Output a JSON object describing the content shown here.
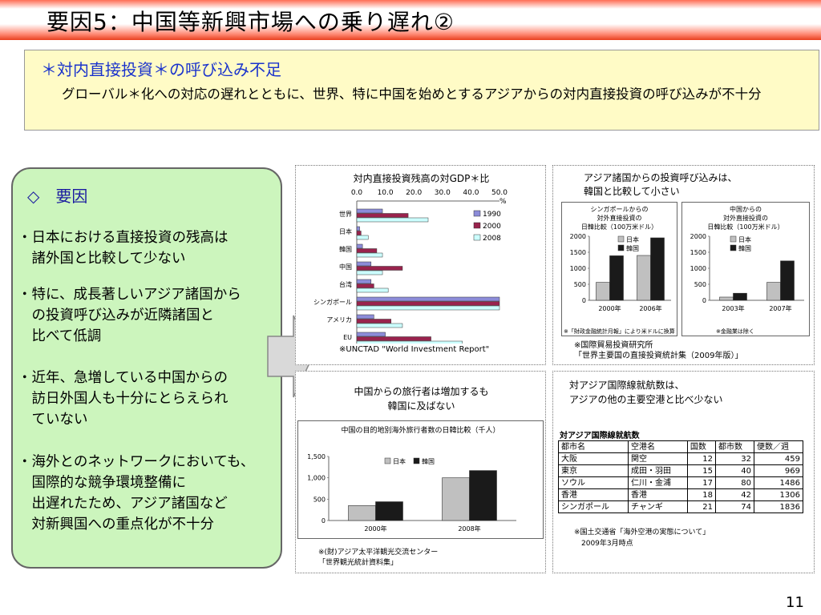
{
  "title": "要因5：中国等新興市場への乗り遅れ②",
  "subtitle": {
    "heading": "＊対内直接投資＊の呼び込み不足",
    "body": "グローバル＊化への対応の遅れとともに、世界、特に中国を始めとするアジアからの対内直接投資の呼び込みが不十分"
  },
  "factors": {
    "heading": "◇　要因",
    "items": [
      "・日本における直接投資の残高は\n　諸外国と比較して少ない",
      "・特に、成長著しいアジア諸国から\n　の投資呼び込みが近隣諸国と\n　比べて低調",
      "・近年、急増している中国からの\n　訪日外国人も十分にとらえられ\n　ていない",
      "・海外とのネットワークにおいても、\n　国際的な競争環境整備に\n　出遅れたため、アジア諸国など\n　対新興国への重点化が不十分"
    ]
  },
  "fdi_panel": {
    "note": "※UNCTAD \"World Investment Report\"",
    "chart_data": {
      "type": "bar",
      "orientation": "horizontal",
      "title": "対内直接投資残高の対GDP＊比",
      "unit": "%",
      "xlim": [
        0,
        50
      ],
      "xticks": [
        "0.0",
        "10.0",
        "20.0",
        "30.0",
        "40.0",
        "50.0"
      ],
      "categories": [
        "世界",
        "日本",
        "韓国",
        "中国",
        "台湾",
        "シンガポール",
        "アメリカ",
        "EU"
      ],
      "series": [
        {
          "name": "1990",
          "color": "#8c8cd9",
          "values": [
            9,
            1,
            2,
            5,
            5,
            50,
            6,
            10
          ]
        },
        {
          "name": "2000",
          "color": "#99234d",
          "values": [
            18,
            1.5,
            7,
            16,
            6,
            50,
            12,
            26
          ]
        },
        {
          "name": "2008",
          "color": "#ccffff",
          "values": [
            25,
            4,
            9,
            9,
            11,
            50,
            16,
            37
          ]
        }
      ]
    }
  },
  "asia_invest_panel": {
    "heading": "アジア諸国からの投資呼び込みは、\n韓国と比較して小さい",
    "note": "※国際貿易投資研究所\n「世界主要国の直接投資統計集（2009年版）」",
    "charts": [
      {
        "type": "bar",
        "title": "シンガポールからの\n対外直接投資の\n日韓比較（100万米ドル）",
        "categories": [
          "2000年",
          "2006年"
        ],
        "ylim": [
          0,
          2000
        ],
        "yticks": [
          "0",
          "500",
          "1000",
          "1500",
          "2000"
        ],
        "series": [
          {
            "name": "日本",
            "color": "#c0c0c0",
            "values": [
              560,
              1400
            ]
          },
          {
            "name": "韓国",
            "color": "#1a1a1a",
            "values": [
              1390,
              1950
            ]
          }
        ],
        "footnote": "※「財政金融統計月報」により米ドルに換算"
      },
      {
        "type": "bar",
        "title": "中国からの\n対外直接投資の\n日韓比較（100万米ドル）",
        "categories": [
          "2003年",
          "2007年"
        ],
        "ylim": [
          0,
          2000
        ],
        "yticks": [
          "0",
          "500",
          "1000",
          "1500",
          "2000"
        ],
        "series": [
          {
            "name": "日本",
            "color": "#c0c0c0",
            "values": [
              100,
              560
            ]
          },
          {
            "name": "韓国",
            "color": "#1a1a1a",
            "values": [
              220,
              1230
            ]
          }
        ],
        "footnote": "※金融業は除く"
      }
    ]
  },
  "tourist_panel": {
    "heading": "中国からの旅行者は増加するも\n韓国に及ばない",
    "note": "※(財)アジア太平洋観光交流センター\n「世界観光統計資料集」",
    "chart_data": {
      "type": "bar",
      "title": "中国の目的地別海外旅行者数の日韓比較（千人）",
      "categories": [
        "2000年",
        "2008年"
      ],
      "ylim": [
        0,
        1500
      ],
      "yticks": [
        "0",
        "500",
        "1,000",
        "1,500"
      ],
      "series": [
        {
          "name": "日本",
          "color": "#c0c0c0",
          "values": [
            350,
            1000
          ]
        },
        {
          "name": "韓国",
          "color": "#1a1a1a",
          "values": [
            440,
            1170
          ]
        }
      ]
    }
  },
  "routes_panel": {
    "heading": "対アジア国際線就航数は、\nアジアの他の主要空港と比べ少ない",
    "table_title": "対アジア国際線就航数",
    "columns": [
      "都市名",
      "空港名",
      "国数",
      "都市数",
      "便数／週"
    ],
    "rows": [
      [
        "大阪",
        "関空",
        "12",
        "32",
        "459"
      ],
      [
        "東京",
        "成田・羽田",
        "15",
        "40",
        "969"
      ],
      [
        "ソウル",
        "仁川・金浦",
        "17",
        "80",
        "1486"
      ],
      [
        "香港",
        "香港",
        "18",
        "42",
        "1306"
      ],
      [
        "シンガポール",
        "チャンギ",
        "21",
        "74",
        "1836"
      ]
    ],
    "note": "※国土交通省「海外空港の実態について」\n　2009年3月時点"
  },
  "page_number": "11"
}
